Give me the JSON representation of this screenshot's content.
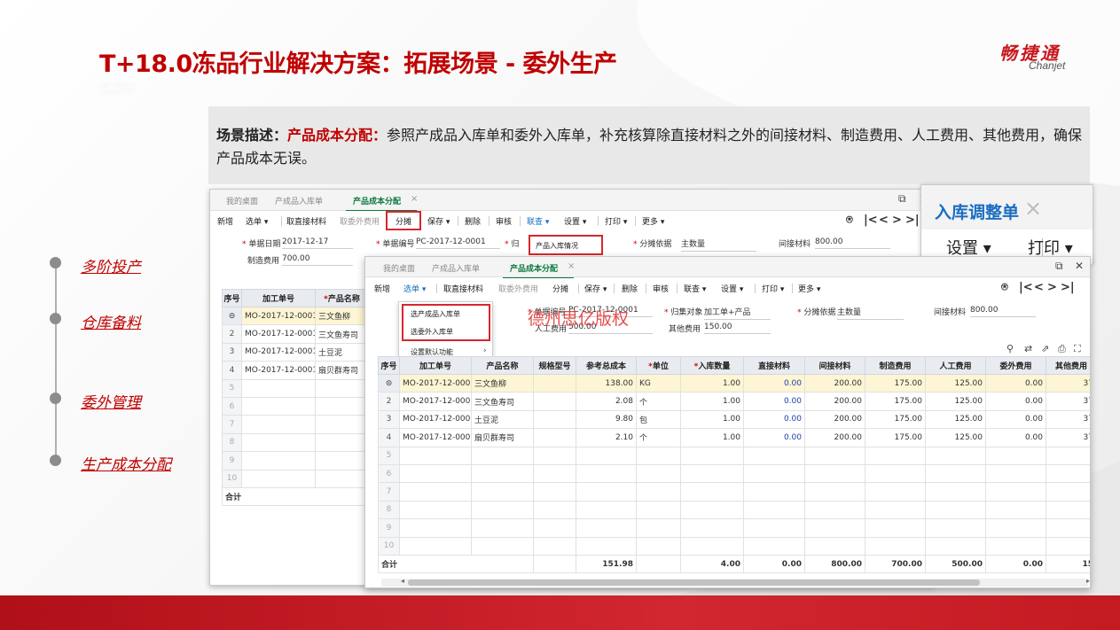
{
  "slide": {
    "title": "T+18.0冻品行业解决方案：拓展场景 - 委外生产",
    "subtitle": "拓展版",
    "logo_cn": "畅捷通",
    "logo_en": "Chanjet"
  },
  "scene": {
    "label": "场景描述：",
    "highlight": "产品成本分配：",
    "text": "参照产成品入库单和委外入库单，补充核算除直接材料之外的间接材料、制造费用、人工费用、其他费用，确保产品成本无误。"
  },
  "timeline": [
    "多阶投产",
    "仓库备料",
    "委外管理",
    "生产成本分配"
  ],
  "back_window": {
    "tabs": [
      "我的桌面",
      "产成品入库单",
      "产品成本分配"
    ],
    "tab_close": "×",
    "controls": {
      "restore": "⧉",
      "close": "✕"
    },
    "toolbar": [
      "新增",
      "选单",
      "取直接材料",
      "取委外费用",
      "分摊",
      "保存",
      "删除",
      "审核",
      "联查",
      "设置",
      "打印",
      "更多"
    ],
    "nav": [
      "⍟",
      "|<",
      "<",
      ">",
      ">|"
    ],
    "popup_item": "产品入库情况",
    "fields": {
      "date_label": "单据日期",
      "date_value": "2017-12-17",
      "bill_label": "单据编号",
      "bill_value": "PC-2017-12-0001",
      "collect_label": "归",
      "alloc_label": "分摊依据",
      "alloc_value": "主数量",
      "indirect_label": "间接材料",
      "indirect_value": "800.00",
      "mfg_label": "制造费用",
      "mfg_value": "700.00"
    },
    "columns": [
      "序号",
      "加工单号",
      "产品名称"
    ],
    "rows": [
      {
        "no": "⊙",
        "order": "MO-2017-12-0001",
        "product": "三文鱼柳"
      },
      {
        "no": "2",
        "order": "MO-2017-12-0001",
        "product": "三文鱼寿司"
      },
      {
        "no": "3",
        "order": "MO-2017-12-0001",
        "product": "土豆泥"
      },
      {
        "no": "4",
        "order": "MO-2017-12-0001",
        "product": "扇贝群寿司"
      },
      {
        "no": "5",
        "order": "",
        "product": ""
      },
      {
        "no": "6",
        "order": "",
        "product": ""
      },
      {
        "no": "7",
        "order": "",
        "product": ""
      },
      {
        "no": "8",
        "order": "",
        "product": ""
      },
      {
        "no": "9",
        "order": "",
        "product": ""
      },
      {
        "no": "10",
        "order": "",
        "product": ""
      }
    ],
    "total_label": "合计"
  },
  "big_window": {
    "tab": "入库调整单",
    "tab_close": "×",
    "settings": "设置",
    "print": "打印"
  },
  "front_window": {
    "tabs": [
      "我的桌面",
      "产成品入库单",
      "产品成本分配"
    ],
    "tab_close": "×",
    "controls": {
      "restore": "⧉",
      "close": "✕"
    },
    "toolbar": [
      "新增",
      "选单",
      "取直接材料",
      "取委外费用",
      "分摊",
      "保存",
      "删除",
      "审核",
      "联查",
      "设置",
      "打印",
      "更多"
    ],
    "nav": [
      "⍟",
      "|<",
      "<",
      ">",
      ">|"
    ],
    "dropdown": [
      "选产成品入库单",
      "选委外入库单",
      "设置默认功能"
    ],
    "watermark": "德州思亿版权",
    "fields": {
      "bill_label": "单据编号",
      "bill_value": "PC-2017-12-0001",
      "labor_label": "人工费用",
      "labor_value": "500.00",
      "collect_label": "归集对象",
      "collect_value": "加工单+产品",
      "other_label": "其他费用",
      "other_value": "150.00",
      "alloc_label": "分摊依据",
      "alloc_value": "主数量",
      "indirect_label": "间接材料",
      "indirect_value": "800.00"
    },
    "icons": [
      "pin-icon",
      "filter-icon",
      "export-icon",
      "print-icon",
      "fullscreen-icon"
    ],
    "columns": [
      "序号",
      "加工单号",
      "产品名称",
      "规格型号",
      "参考总成本",
      "单位",
      "入库数量",
      "直接材料",
      "间接材料",
      "制造费用",
      "人工费用",
      "委外费用",
      "其他费用"
    ],
    "rows": [
      {
        "no": "⊙",
        "order": "MO-2017-12-0001",
        "product": "三文鱼柳",
        "spec": "",
        "cost": "138.00",
        "unit": "KG",
        "qty": "1.00",
        "direct": "0.00",
        "indirect": "200.00",
        "mfg": "175.00",
        "labor": "125.00",
        "outsource": "0.00",
        "other": "37"
      },
      {
        "no": "2",
        "order": "MO-2017-12-0001",
        "product": "三文鱼寿司",
        "spec": "",
        "cost": "2.08",
        "unit": "个",
        "qty": "1.00",
        "direct": "0.00",
        "indirect": "200.00",
        "mfg": "175.00",
        "labor": "125.00",
        "outsource": "0.00",
        "other": "37"
      },
      {
        "no": "3",
        "order": "MO-2017-12-0001",
        "product": "土豆泥",
        "spec": "",
        "cost": "9.80",
        "unit": "包",
        "qty": "1.00",
        "direct": "0.00",
        "indirect": "200.00",
        "mfg": "175.00",
        "labor": "125.00",
        "outsource": "0.00",
        "other": "37"
      },
      {
        "no": "4",
        "order": "MO-2017-12-0001",
        "product": "扇贝群寿司",
        "spec": "",
        "cost": "2.10",
        "unit": "个",
        "qty": "1.00",
        "direct": "0.00",
        "indirect": "200.00",
        "mfg": "175.00",
        "labor": "125.00",
        "outsource": "0.00",
        "other": "37"
      }
    ],
    "empty_rows": [
      "5",
      "6",
      "7",
      "8",
      "9",
      "10"
    ],
    "totals": {
      "label": "合计",
      "cost": "151.98",
      "qty": "4.00",
      "direct": "0.00",
      "indirect": "800.00",
      "mfg": "700.00",
      "labor": "500.00",
      "outsource": "0.00",
      "other": "15"
    }
  },
  "colors": {
    "brand_red": "#c00000",
    "accent_green": "#0d7a3f",
    "highlight_row": "#fdf5d4"
  }
}
